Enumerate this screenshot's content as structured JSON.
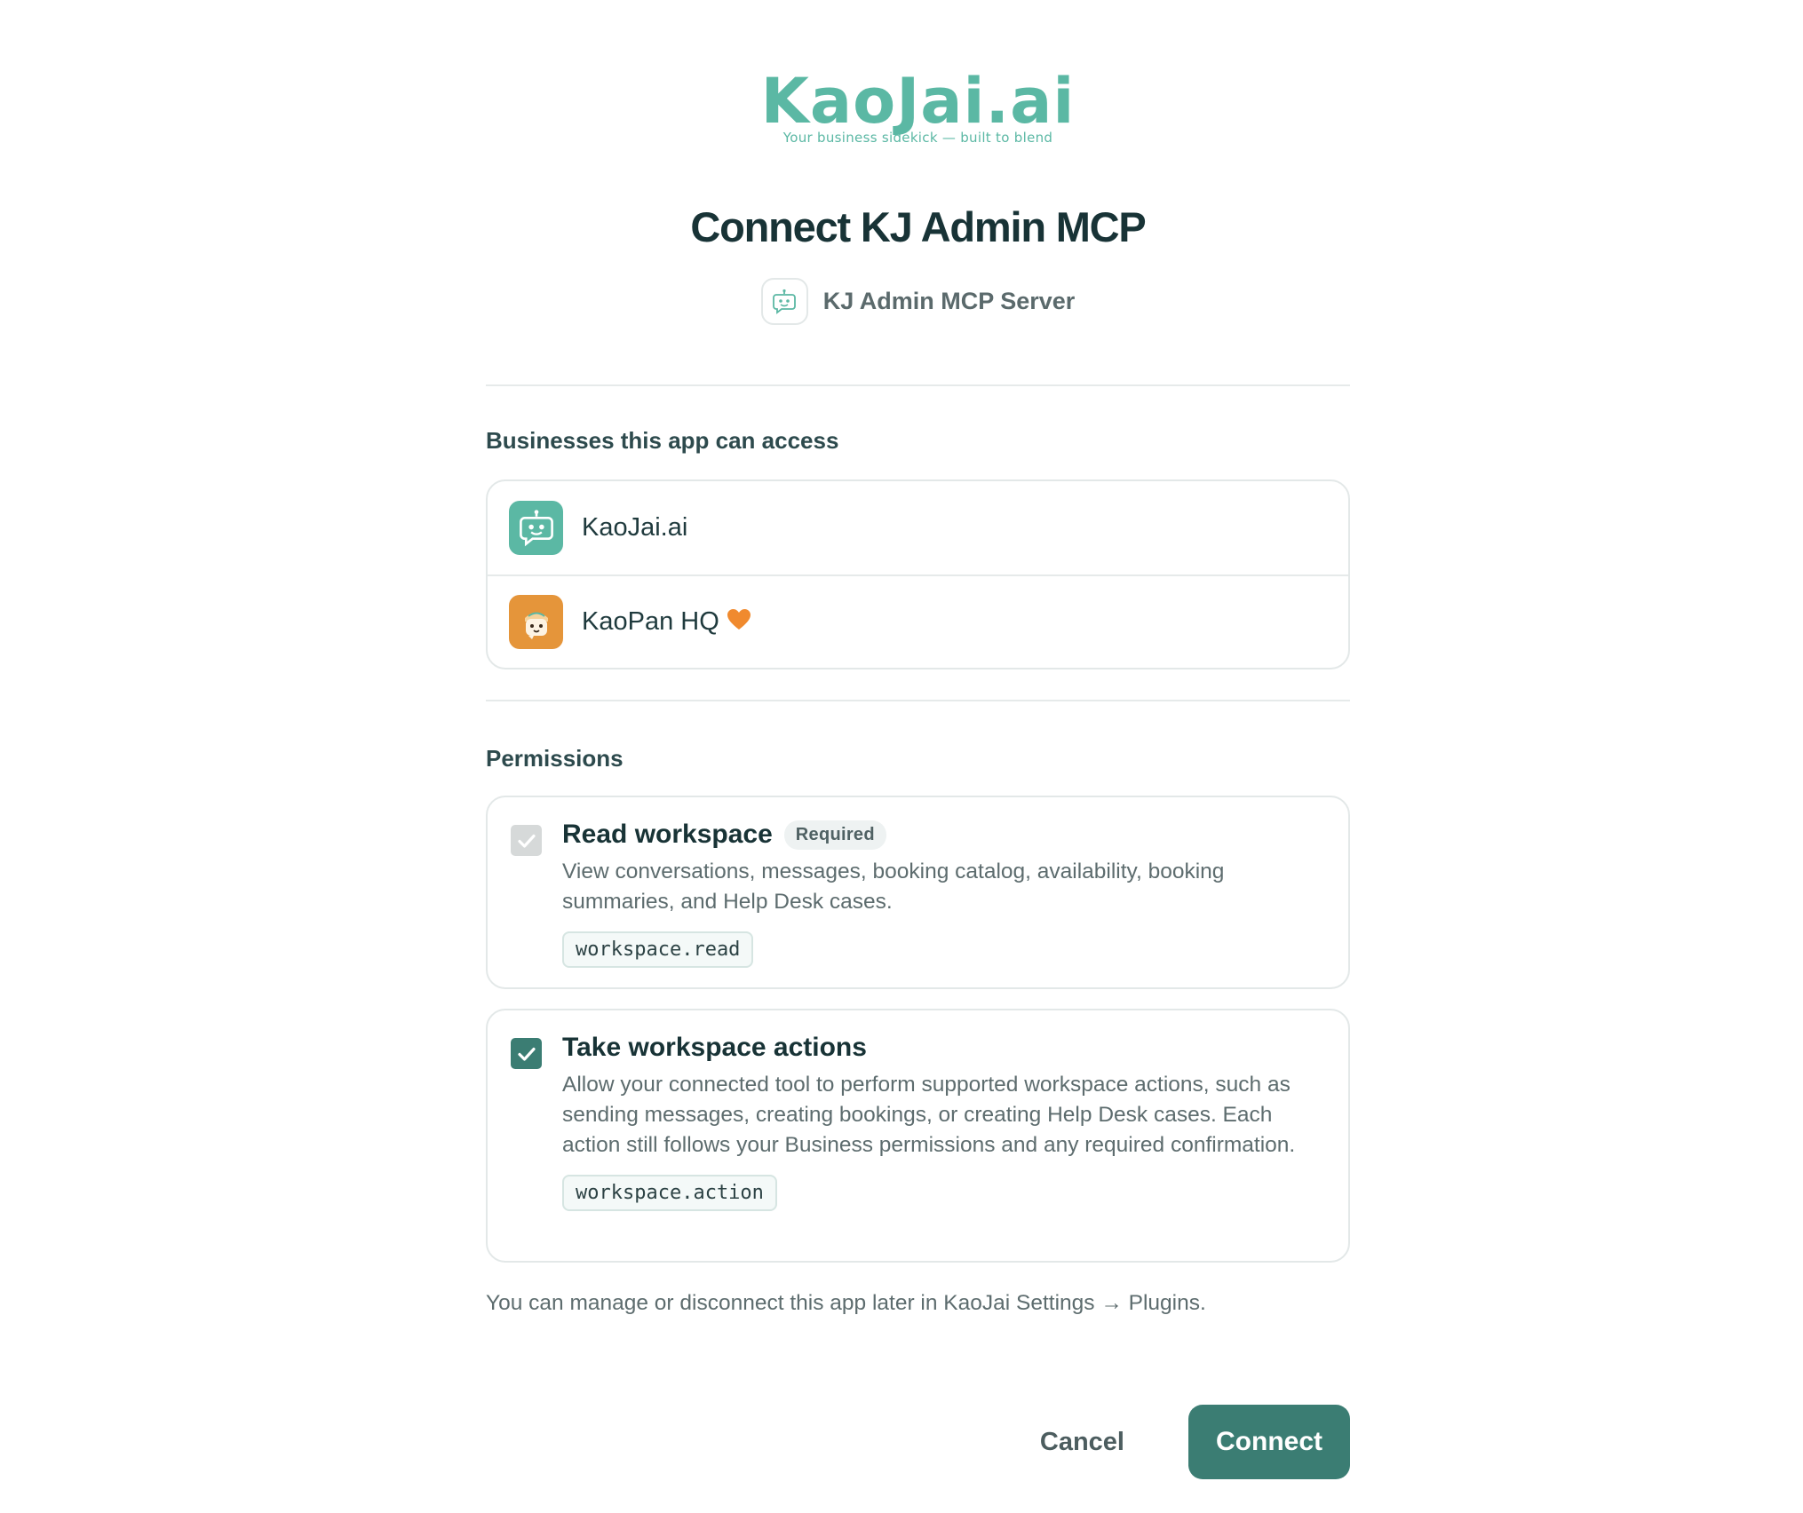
{
  "brand": {
    "logo_text": "KaoJai.ai",
    "tagline": "Your business sidekick — built to blend",
    "accent_color": "#5bb8a4"
  },
  "header": {
    "title": "Connect KJ Admin MCP",
    "server_icon": "robot-chat-icon",
    "server_name": "KJ Admin MCP Server"
  },
  "businesses": {
    "heading": "Businesses this app can access",
    "items": [
      {
        "name": "KaoJai.ai",
        "icon": "robot-chat-icon",
        "avatar_color": "#5bb8a4"
      },
      {
        "name": "KaoPan HQ",
        "icon": "mascot-avatar-icon",
        "avatar_color": "#e5953a",
        "emoji": "orange-heart-icon"
      }
    ]
  },
  "permissions": {
    "heading": "Permissions",
    "items": [
      {
        "title": "Read workspace",
        "badge": "Required",
        "description": "View conversations, messages, booking catalog, availability, booking summaries, and Help Desk cases.",
        "scope": "workspace.read",
        "checked": true,
        "disabled": true
      },
      {
        "title": "Take workspace actions",
        "description": "Allow your connected tool to perform supported workspace actions, such as sending messages, creating bookings, or creating Help Desk cases. Each action still follows your Business permissions and any required confirmation.",
        "scope": "workspace.action",
        "checked": true,
        "disabled": false
      }
    ]
  },
  "footnote": "You can manage or disconnect this app later in KaoJai Settings → Plugins.",
  "actions": {
    "cancel_label": "Cancel",
    "connect_label": "Connect",
    "primary_color": "#3b7d73"
  }
}
